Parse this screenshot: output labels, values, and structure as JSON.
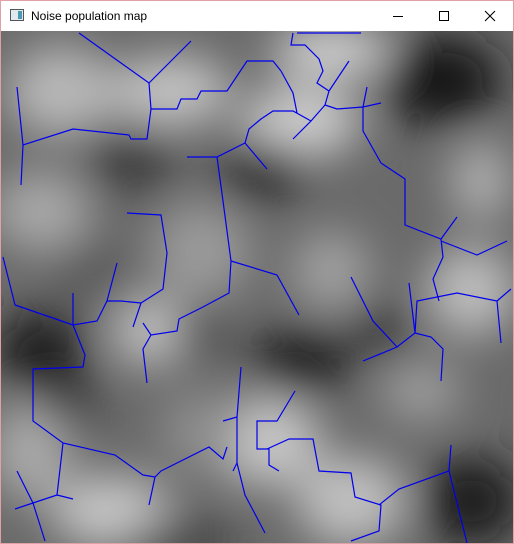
{
  "window": {
    "title": "Noise population map",
    "controls": {
      "minimize": "minimize-icon",
      "maximize": "maximize-icon",
      "close": "close-icon"
    }
  },
  "map": {
    "background": "grayscale noise",
    "river_color": "#0000ee"
  }
}
